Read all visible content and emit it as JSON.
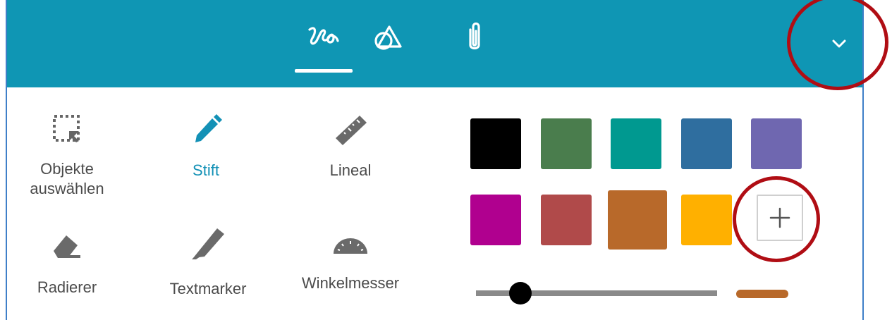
{
  "toolbar": {
    "tabs": [
      {
        "icon": "ink-scribble-icon",
        "active": true
      },
      {
        "icon": "shapes-icon",
        "active": false
      },
      {
        "icon": "paperclip-icon",
        "active": false
      }
    ],
    "collapse_icon": "chevron-down-icon"
  },
  "tools": {
    "select": {
      "label_line1": "Objekte",
      "label_line2": "auswählen",
      "icon": "selection-icon"
    },
    "pen": {
      "label": "Stift",
      "icon": "pencil-icon",
      "active": true
    },
    "ruler": {
      "label": "Lineal",
      "icon": "ruler-icon"
    },
    "eraser": {
      "label": "Radierer",
      "icon": "eraser-icon"
    },
    "highlighter": {
      "label": "Textmarker",
      "icon": "highlighter-icon"
    },
    "protractor": {
      "label": "Winkelmesser",
      "icon": "protractor-icon"
    }
  },
  "colors": {
    "row1": [
      "#000000",
      "#4a7d4d",
      "#009990",
      "#2f6e9f",
      "#6f67b0"
    ],
    "row2": [
      "#b0008f",
      "#b04a4a",
      "#b8692a",
      "#ffb000"
    ],
    "selected": "#b8692a",
    "add_icon": "plus-icon"
  },
  "stroke": {
    "width_level": 0.2,
    "preview_color": "#b8692a"
  },
  "accent": "#0f96b4",
  "annotation_color": "#b00d14"
}
